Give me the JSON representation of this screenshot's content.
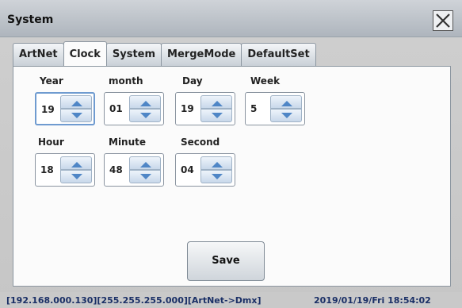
{
  "window": {
    "title": "System"
  },
  "tabs": [
    {
      "label": "ArtNet",
      "active": false
    },
    {
      "label": "Clock",
      "active": true
    },
    {
      "label": "System",
      "active": false
    },
    {
      "label": "MergeMode",
      "active": false
    },
    {
      "label": "DefaultSet",
      "active": false
    }
  ],
  "clock": {
    "year": {
      "label": "Year",
      "value": "19"
    },
    "month": {
      "label": "month",
      "value": "01"
    },
    "day": {
      "label": "Day",
      "value": "19"
    },
    "week": {
      "label": "Week",
      "value": "5"
    },
    "hour": {
      "label": "Hour",
      "value": "18"
    },
    "minute": {
      "label": "Minute",
      "value": "48"
    },
    "second": {
      "label": "Second",
      "value": "04"
    }
  },
  "save_label": "Save",
  "status": {
    "network": "[192.168.000.130][255.255.255.000][ArtNet->Dmx]",
    "datetime": "2019/01/19/Fri  18:54:02"
  },
  "colors": {
    "focus_border": "#6f9bd0",
    "arrow": "#4f86c6",
    "status_text": "#1a2f66"
  },
  "icons": {
    "close": "close-icon",
    "spin_up": "chevron-up-icon",
    "spin_down": "chevron-down-icon"
  }
}
